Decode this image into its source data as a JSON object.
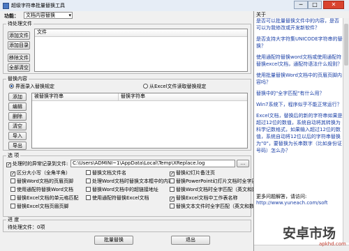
{
  "app": {
    "title": "超级字符串批量替换工具",
    "min": "─",
    "max": "□",
    "close": "✕"
  },
  "function": {
    "label": "功能：",
    "selected": "文档内容替换"
  },
  "pending": {
    "title": "待处理文件",
    "buttons": [
      "添加文件",
      "添加目录",
      "移除文件",
      "全部清空"
    ],
    "column": "文件"
  },
  "replace": {
    "title": "替换内容",
    "radio_manual": "界面录入替换规定",
    "radio_excel": "从Excel文件读取替换规定",
    "buttons": [
      "添加",
      "编辑",
      "删除",
      "清空",
      "导入",
      "导出"
    ],
    "col_from": "被替换字符串",
    "col_to": "替换字符串"
  },
  "options": {
    "title": "选  项",
    "log_label": "处理时的异常记录到文件:",
    "log_path": "C:\\Users\\ADMINI~1\\AppData\\Local\\Temp\\XReplace.log",
    "browse": "...",
    "col1": [
      {
        "label": "区分大小写（全角半角）",
        "checked": true
      },
      {
        "label": "替换Word文档的页眉页脚",
        "checked": false
      },
      {
        "label": "使用通配符替换Word文档",
        "checked": false
      },
      {
        "label": "替换Excel文档的单元格匹配",
        "checked": false
      },
      {
        "label": "替换Excel文档页眉页脚",
        "checked": false
      }
    ],
    "col2": [
      {
        "label": "替换文档文件名",
        "checked": false
      },
      {
        "label": "处理Word文档时替换文本框中的内容",
        "checked": false
      },
      {
        "label": "替换Word文档中的超链接地址",
        "checked": false
      },
      {
        "label": "使用通配符替换Excel文档",
        "checked": false
      }
    ],
    "col3": [
      {
        "label": "替换幻灯片备注页",
        "checked": true
      },
      {
        "label": "替换PowerPoint幻灯片文档时全字匹配",
        "checked": false
      },
      {
        "label": "替换Word文档时全字匹配（英文和数字）",
        "checked": false
      },
      {
        "label": "替换Excel文档中工作表名称",
        "checked": false
      },
      {
        "label": "替换文本文件时全字匹配（英文和数字）",
        "checked": false
      }
    ]
  },
  "progress": {
    "title": "进  度",
    "status": "待处理文件：0项"
  },
  "actions": {
    "run": "批量替换",
    "exit": "退出"
  },
  "sidebar": {
    "title": "关于",
    "links": [
      "是否可以批量替换文件中的内容，是否可以为我修改或开发新软件？",
      "是否支持大字符集UNICODE字符串的替换？",
      "使用通配符替换word文档或使用通配符替换excel文档，通配符语法什么规则？",
      "使用批量替换Word文档中的页眉页脚内容吗？",
      "替换中的\"全字匹配\"有什么用？",
      "Win7系统下，程序似乎不能正常运行？",
      "Excel文档，替换后的新的字符串如果是超过12位的数值，系统自动将其转换为科学记数格式，如果输入超过12位的数值，系统自动将12位以后的字符串替换为\"0\"，要替换为长串数字（比如身份证号码）怎么办？"
    ],
    "more_label": "更多问题解答，请访问:",
    "url": "http://www.yuneach.com/soft"
  },
  "watermark": {
    "big": "安卓市场",
    "small": "apkhd.com"
  },
  "colors": {
    "title_bg": "#e6edf6",
    "link": "#1a3fa6",
    "close": "#d9432f"
  }
}
